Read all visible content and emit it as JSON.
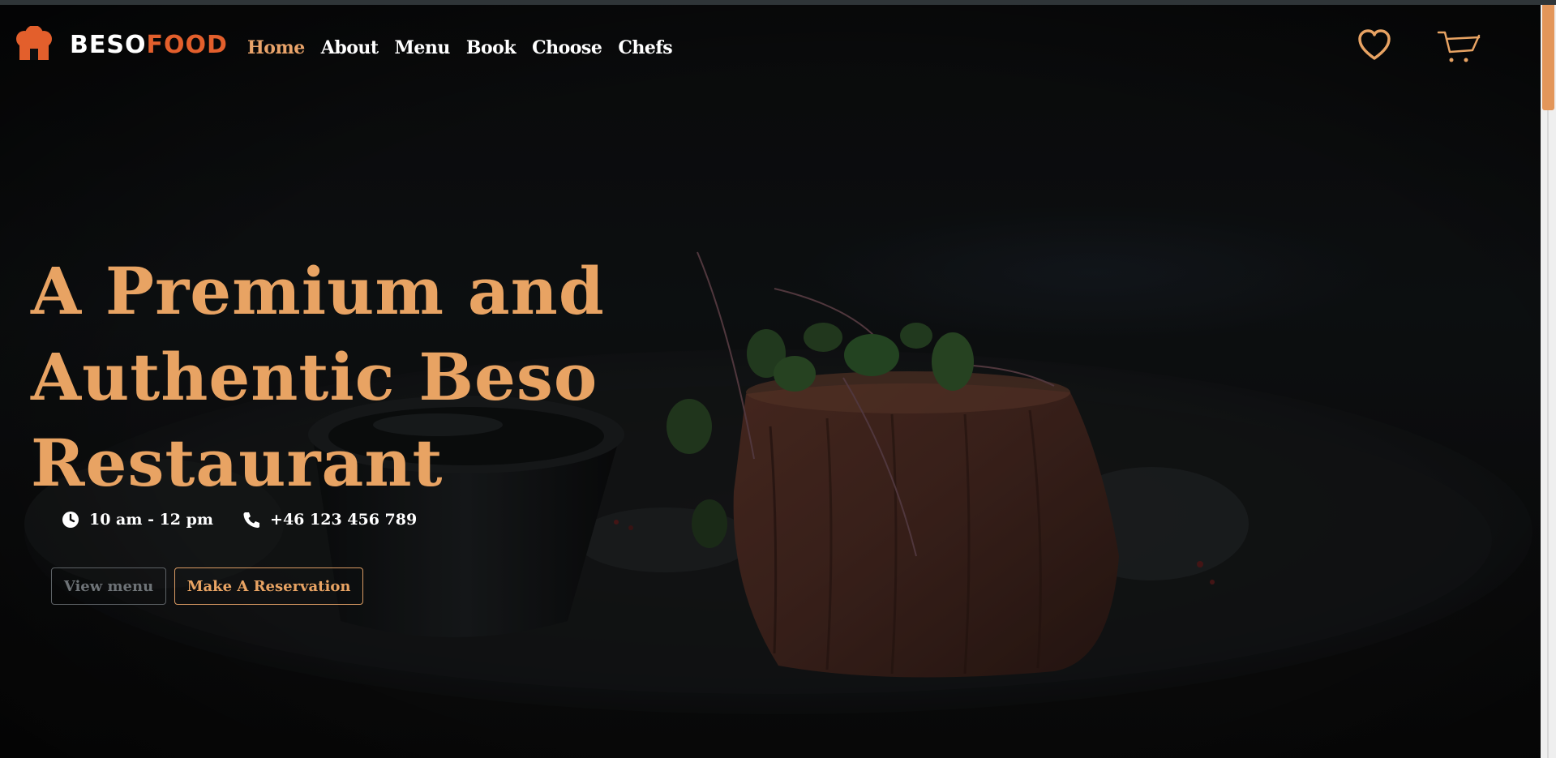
{
  "brand": {
    "name_part1": "BESO",
    "name_part2": "FOOD",
    "accent_color": "#e35f2c"
  },
  "nav": {
    "items": [
      {
        "label": "Home",
        "active": true
      },
      {
        "label": "About",
        "active": false
      },
      {
        "label": "Menu",
        "active": false
      },
      {
        "label": "Book",
        "active": false
      },
      {
        "label": "Choose",
        "active": false
      },
      {
        "label": "Chefs",
        "active": false
      }
    ]
  },
  "header_icons": {
    "favorites": "heart-icon",
    "cart": "cart-icon"
  },
  "hero": {
    "headline_line1": "A Premium and",
    "headline_line2": "Authentic Beso",
    "headline_line3": "Restaurant",
    "hours": "10 am - 12 pm",
    "phone": "+46 123 456 789",
    "view_menu_label": "View menu",
    "reservation_label": "Make A Reservation"
  },
  "theme": {
    "accent": "#e8a363",
    "background": "#0c0c0c"
  }
}
